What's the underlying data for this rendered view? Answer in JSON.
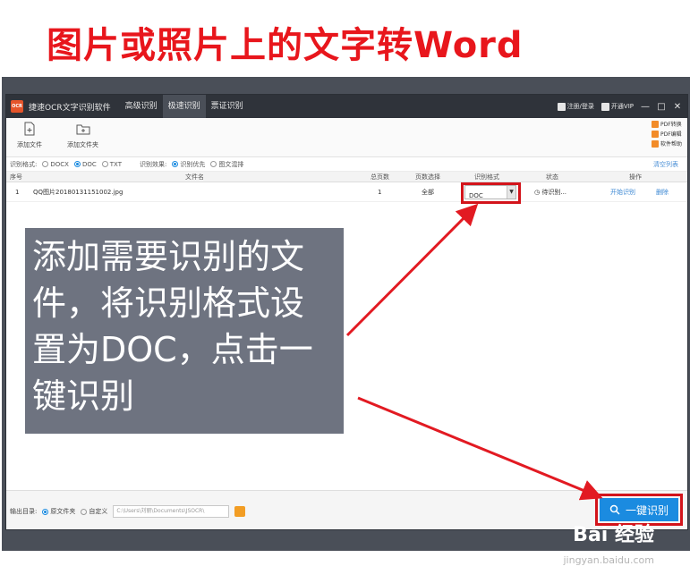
{
  "headline": "图片或照片上的文字转Word",
  "app": {
    "title": "捷速OCR文字识别软件",
    "nav_tabs": [
      "高级识别",
      "极速识别",
      "票证识别"
    ],
    "active_tab": "极速识别",
    "account": "注册/登录",
    "vip": "开通VIP",
    "window_buttons": [
      "—",
      "□",
      "✕"
    ]
  },
  "toolbar": {
    "add_file": "添加文件",
    "add_folder": "添加文件夹",
    "side_links": [
      "PDF转换",
      "PDF编辑",
      "软件帮助"
    ]
  },
  "options": {
    "format_label": "识别格式:",
    "formats": [
      "DOCX",
      "DOC",
      "TXT"
    ],
    "selected_format": "DOC",
    "effect_label": "识别效果:",
    "effects": [
      "识别优先",
      "图文混排"
    ],
    "selected_effect": "识别优先",
    "clear_list": "清空列表"
  },
  "table": {
    "headers": [
      "序号",
      "文件名",
      "总页数",
      "页数选择",
      "识别格式",
      "状态",
      "操作"
    ],
    "rows": [
      {
        "index": "1",
        "filename": "QQ图片20180131151002.jpg",
        "pages": "1",
        "page_select": "全部",
        "format": "DOC",
        "status": "待识别...",
        "action_start": "开始识别",
        "action_delete": "删除"
      }
    ]
  },
  "callout": "添加需要识别的文件，将识别格式设置为DOC，点击一键识别",
  "bottom": {
    "output_label": "输出目录:",
    "original_folder": "原文件夹",
    "custom": "自定义",
    "path": "C:\\Users\\刘丽\\Documents\\JSOCR\\",
    "recognize_button": "一键识别"
  },
  "watermark": {
    "brand": "Bai 经验",
    "url": "jingyan.baidu.com"
  },
  "colors": {
    "headline": "#e8161c",
    "titlebar": "#2f333a",
    "accent_blue": "#1b8be0",
    "highlight_red": "#d3141b",
    "callout_bg": "#6e7380"
  }
}
